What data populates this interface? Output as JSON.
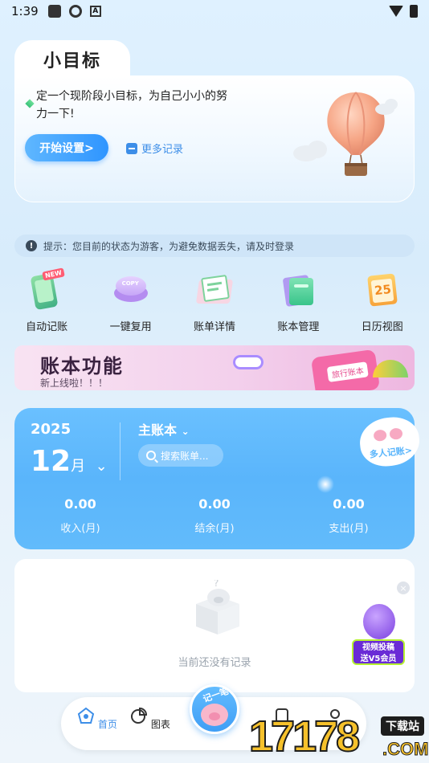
{
  "status_bar": {
    "time": "1:39"
  },
  "goal": {
    "title": "小目标",
    "description": "定一个现阶段小目标，为自己小小的努力一下!",
    "start_button": "开始设置>",
    "more_records": "更多记录"
  },
  "tip": {
    "text": "提示：您目前的状态为游客，为避免数据丢失，请及时登录",
    "icon": "!"
  },
  "features": [
    {
      "label": "自动记账",
      "icon": "phone-icon",
      "badge": "NEW"
    },
    {
      "label": "一键复用",
      "icon": "copy-button-icon",
      "badge_text": "COPY"
    },
    {
      "label": "账单详情",
      "icon": "bill-detail-icon"
    },
    {
      "label": "账本管理",
      "icon": "ledger-book-icon"
    },
    {
      "label": "日历视图",
      "icon": "calendar-icon",
      "calendar_day": "25"
    }
  ],
  "banner": {
    "title": "账本功能",
    "subtitle": "新上线啦！！！",
    "card_label": "旅行账本"
  },
  "ledger": {
    "year": "2025",
    "month_num": "12",
    "month_unit": "月",
    "book_name": "主账本",
    "search_placeholder": "搜索账单...",
    "multi_user": "多人记账>",
    "income": {
      "value": "0.00",
      "label": "收入(月)"
    },
    "balance": {
      "value": "0.00",
      "label": "结余(月)"
    },
    "expense": {
      "value": "0.00",
      "label": "支出(月)"
    }
  },
  "empty_state": {
    "text": "当前还没有记录",
    "promo_line1": "视频投稿",
    "promo_line2": "送V5会员"
  },
  "tabbar": {
    "home": "首页",
    "chart": "图表",
    "fab_label": "记一笔"
  },
  "watermark": {
    "number": "17178",
    "tag": "下载站",
    "domain": ".COM"
  },
  "colors": {
    "accent": "#3d8ee8",
    "ledger_blue": "#5ab5fb",
    "banner_pink": "#f3d0ec"
  }
}
